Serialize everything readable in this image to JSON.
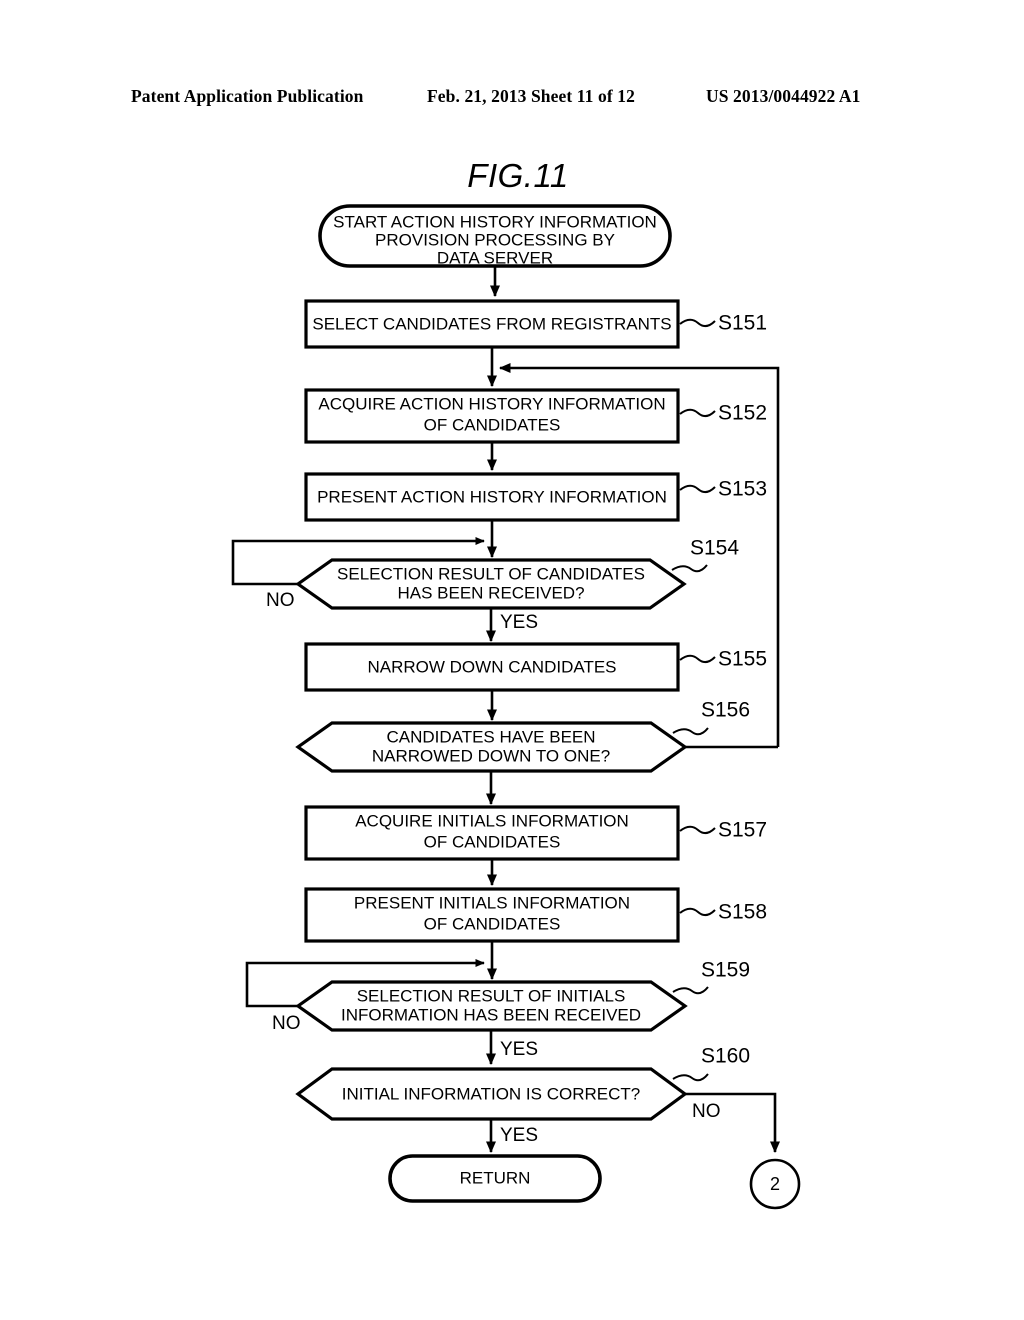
{
  "header": {
    "left": "Patent Application Publication",
    "middle": "Feb. 21, 2013  Sheet 11 of 12",
    "right": "US 2013/0044922 A1"
  },
  "figure": {
    "title": "FIG.11"
  },
  "nodes": {
    "start": {
      "kind": "terminal",
      "line1": "START ACTION HISTORY INFORMATION",
      "line2": "PROVISION PROCESSING BY",
      "line3": "DATA SERVER"
    },
    "s151": {
      "kind": "process",
      "label": "S151",
      "line1": "SELECT CANDIDATES FROM REGISTRANTS"
    },
    "s152": {
      "kind": "process",
      "label": "S152",
      "line1": "ACQUIRE ACTION HISTORY INFORMATION",
      "line2": "OF CANDIDATES"
    },
    "s153": {
      "kind": "process",
      "label": "S153",
      "line1": "PRESENT ACTION HISTORY INFORMATION"
    },
    "s154": {
      "kind": "decision",
      "label": "S154",
      "line1": "SELECTION RESULT OF CANDIDATES",
      "line2": "HAS BEEN RECEIVED?",
      "no": "NO",
      "yes": "YES"
    },
    "s155": {
      "kind": "process",
      "label": "S155",
      "line1": "NARROW DOWN CANDIDATES"
    },
    "s156": {
      "kind": "decision",
      "label": "S156",
      "line1": "CANDIDATES HAVE BEEN",
      "line2": "NARROWED DOWN TO ONE?"
    },
    "s157": {
      "kind": "process",
      "label": "S157",
      "line1": "ACQUIRE INITIALS INFORMATION",
      "line2": "OF CANDIDATES"
    },
    "s158": {
      "kind": "process",
      "label": "S158",
      "line1": "PRESENT INITIALS INFORMATION",
      "line2": "OF CANDIDATES"
    },
    "s159": {
      "kind": "decision",
      "label": "S159",
      "line1": "SELECTION RESULT OF INITIALS",
      "line2": "INFORMATION HAS BEEN RECEIVED",
      "no": "NO",
      "yes": "YES"
    },
    "s160": {
      "kind": "decision",
      "label": "S160",
      "line1": "INITIAL INFORMATION IS CORRECT?",
      "no": "NO",
      "yes": "YES"
    },
    "return": {
      "kind": "terminal",
      "line1": "RETURN"
    },
    "connector": {
      "kind": "connector",
      "label": "2"
    }
  },
  "chart_data": {
    "type": "diagram",
    "title": "FIG.11",
    "diagram_kind": "flowchart",
    "steps": [
      {
        "id": "start",
        "shape": "stadium",
        "text": "START ACTION HISTORY INFORMATION PROVISION PROCESSING BY DATA SERVER"
      },
      {
        "id": "S151",
        "shape": "rect",
        "text": "SELECT CANDIDATES FROM REGISTRANTS"
      },
      {
        "id": "S152",
        "shape": "rect",
        "text": "ACQUIRE ACTION HISTORY INFORMATION OF CANDIDATES"
      },
      {
        "id": "S153",
        "shape": "rect",
        "text": "PRESENT ACTION HISTORY INFORMATION"
      },
      {
        "id": "S154",
        "shape": "hexagon",
        "text": "SELECTION RESULT OF CANDIDATES HAS BEEN RECEIVED?"
      },
      {
        "id": "S155",
        "shape": "rect",
        "text": "NARROW DOWN CANDIDATES"
      },
      {
        "id": "S156",
        "shape": "hexagon",
        "text": "CANDIDATES HAVE BEEN NARROWED DOWN TO ONE?"
      },
      {
        "id": "S157",
        "shape": "rect",
        "text": "ACQUIRE INITIALS INFORMATION OF CANDIDATES"
      },
      {
        "id": "S158",
        "shape": "rect",
        "text": "PRESENT INITIALS INFORMATION OF CANDIDATES"
      },
      {
        "id": "S159",
        "shape": "hexagon",
        "text": "SELECTION RESULT OF INITIALS INFORMATION HAS BEEN RECEIVED"
      },
      {
        "id": "S160",
        "shape": "hexagon",
        "text": "INITIAL INFORMATION IS CORRECT?"
      },
      {
        "id": "RETURN",
        "shape": "stadium",
        "text": "RETURN"
      },
      {
        "id": "2",
        "shape": "circle",
        "text": "2"
      }
    ],
    "edges": [
      {
        "from": "start",
        "to": "S151",
        "label": ""
      },
      {
        "from": "S151",
        "to": "S152",
        "label": ""
      },
      {
        "from": "S152",
        "to": "S153",
        "label": ""
      },
      {
        "from": "S153",
        "to": "S154",
        "label": ""
      },
      {
        "from": "S154",
        "to": "S154",
        "label": "NO"
      },
      {
        "from": "S154",
        "to": "S155",
        "label": "YES"
      },
      {
        "from": "S155",
        "to": "S156",
        "label": ""
      },
      {
        "from": "S156",
        "to": "S152",
        "label": ""
      },
      {
        "from": "S156",
        "to": "S157",
        "label": ""
      },
      {
        "from": "S157",
        "to": "S158",
        "label": ""
      },
      {
        "from": "S158",
        "to": "S159",
        "label": ""
      },
      {
        "from": "S159",
        "to": "S159",
        "label": "NO"
      },
      {
        "from": "S159",
        "to": "S160",
        "label": "YES"
      },
      {
        "from": "S160",
        "to": "RETURN",
        "label": "YES"
      },
      {
        "from": "S160",
        "to": "2",
        "label": "NO"
      }
    ]
  }
}
